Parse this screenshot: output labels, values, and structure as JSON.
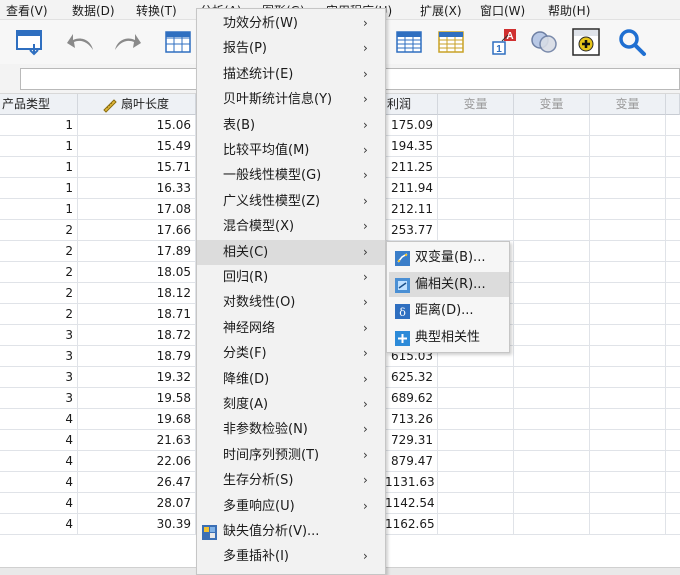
{
  "menubar": {
    "items": [
      "查看(V)",
      "数据(D)",
      "转换(T)",
      "分析(A)",
      "图形(G)",
      "实用程序(U)",
      "扩展(X)",
      "窗口(W)",
      "帮助(H)"
    ]
  },
  "grid": {
    "headers": [
      "产品类型",
      "扇叶长度",
      "利润",
      "变量",
      "变量",
      "变量"
    ],
    "rows": [
      [
        "1",
        "15.06",
        "175.09"
      ],
      [
        "1",
        "15.49",
        "194.35"
      ],
      [
        "1",
        "15.71",
        "211.25"
      ],
      [
        "1",
        "16.33",
        "211.94"
      ],
      [
        "1",
        "17.08",
        "212.11"
      ],
      [
        "2",
        "17.66",
        "253.77"
      ],
      [
        "2",
        "17.89",
        ""
      ],
      [
        "2",
        "18.05",
        ""
      ],
      [
        "2",
        "18.12",
        ""
      ],
      [
        "2",
        "18.71",
        ""
      ],
      [
        "3",
        "18.72",
        ""
      ],
      [
        "3",
        "18.79",
        "615.03"
      ],
      [
        "3",
        "19.32",
        "625.32"
      ],
      [
        "3",
        "19.58",
        "689.62"
      ],
      [
        "4",
        "19.68",
        "713.26"
      ],
      [
        "4",
        "21.63",
        "729.31"
      ],
      [
        "4",
        "22.06",
        "879.47"
      ],
      [
        "4",
        "26.47",
        "1131.63"
      ],
      [
        "4",
        "28.07",
        "1142.54"
      ],
      [
        "4",
        "30.39",
        "1162.65"
      ]
    ]
  },
  "menu": {
    "items": [
      {
        "label": "功效分析(W)",
        "submenu": true
      },
      {
        "label": "报告(P)",
        "submenu": true
      },
      {
        "label": "描述统计(E)",
        "submenu": true
      },
      {
        "label": "贝叶斯统计信息(Y)",
        "submenu": true
      },
      {
        "label": "表(B)",
        "submenu": true
      },
      {
        "label": "比较平均值(M)",
        "submenu": true
      },
      {
        "label": "一般线性模型(G)",
        "submenu": true
      },
      {
        "label": "广义线性模型(Z)",
        "submenu": true
      },
      {
        "label": "混合模型(X)",
        "submenu": true
      },
      {
        "label": "相关(C)",
        "submenu": true,
        "highlighted": true
      },
      {
        "label": "回归(R)",
        "submenu": true
      },
      {
        "label": "对数线性(O)",
        "submenu": true
      },
      {
        "label": "神经网络",
        "submenu": true
      },
      {
        "label": "分类(F)",
        "submenu": true
      },
      {
        "label": "降维(D)",
        "submenu": true
      },
      {
        "label": "刻度(A)",
        "submenu": true
      },
      {
        "label": "非参数检验(N)",
        "submenu": true
      },
      {
        "label": "时间序列预测(T)",
        "submenu": true
      },
      {
        "label": "生存分析(S)",
        "submenu": true
      },
      {
        "label": "多重响应(U)",
        "submenu": true
      },
      {
        "label": "缺失值分析(V)...",
        "submenu": false,
        "icon": "missing-value-icon"
      },
      {
        "label": "多重插补(I)",
        "submenu": true
      }
    ]
  },
  "submenu": {
    "items": [
      {
        "label": "双变量(B)...",
        "icon": "bivariate-icon",
        "color": "#3a7ec9"
      },
      {
        "label": "偏相关(R)...",
        "icon": "partial-correlation-icon",
        "color": "#4a8fd4",
        "highlighted": true
      },
      {
        "label": "距离(D)...",
        "icon": "distance-icon",
        "color": "#2f6fc0"
      },
      {
        "label": "典型相关性",
        "icon": "canonical-correlation-icon",
        "color": "#2c8ad8"
      }
    ]
  },
  "colors": {
    "accent": "#1f6fd1",
    "menu_highlight": "#dcdcdc",
    "header_bg": "#eef1f5"
  }
}
